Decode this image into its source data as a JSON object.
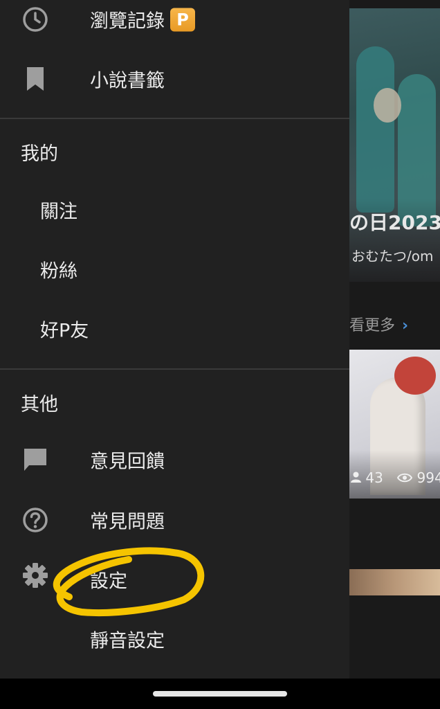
{
  "background": {
    "work_title": "の日2023",
    "work_author": "おむたつ/om",
    "see_more": "看更多",
    "chevron": "›",
    "stats_likes": "43",
    "stats_views": "994"
  },
  "drawer": {
    "top_items": [
      {
        "label": "瀏覽記錄",
        "icon": "clock-icon",
        "badge": "P"
      },
      {
        "label": "小說書籤",
        "icon": "bookmark-icon"
      }
    ],
    "mine": {
      "heading": "我的",
      "items": [
        {
          "label": "關注"
        },
        {
          "label": "粉絲"
        },
        {
          "label": "好P友"
        }
      ]
    },
    "other": {
      "heading": "其他",
      "items": [
        {
          "label": "意見回饋",
          "icon": "feedback-icon"
        },
        {
          "label": "常見問題",
          "icon": "help-circle-icon"
        },
        {
          "label": "設定",
          "icon": "gear-icon"
        },
        {
          "label": "靜音設定"
        }
      ]
    }
  },
  "colors": {
    "drawer_bg": "#212121",
    "premium_badge": "#f0a733",
    "annotation_circle": "#f5c400",
    "link_accent": "#4a8fd6"
  }
}
